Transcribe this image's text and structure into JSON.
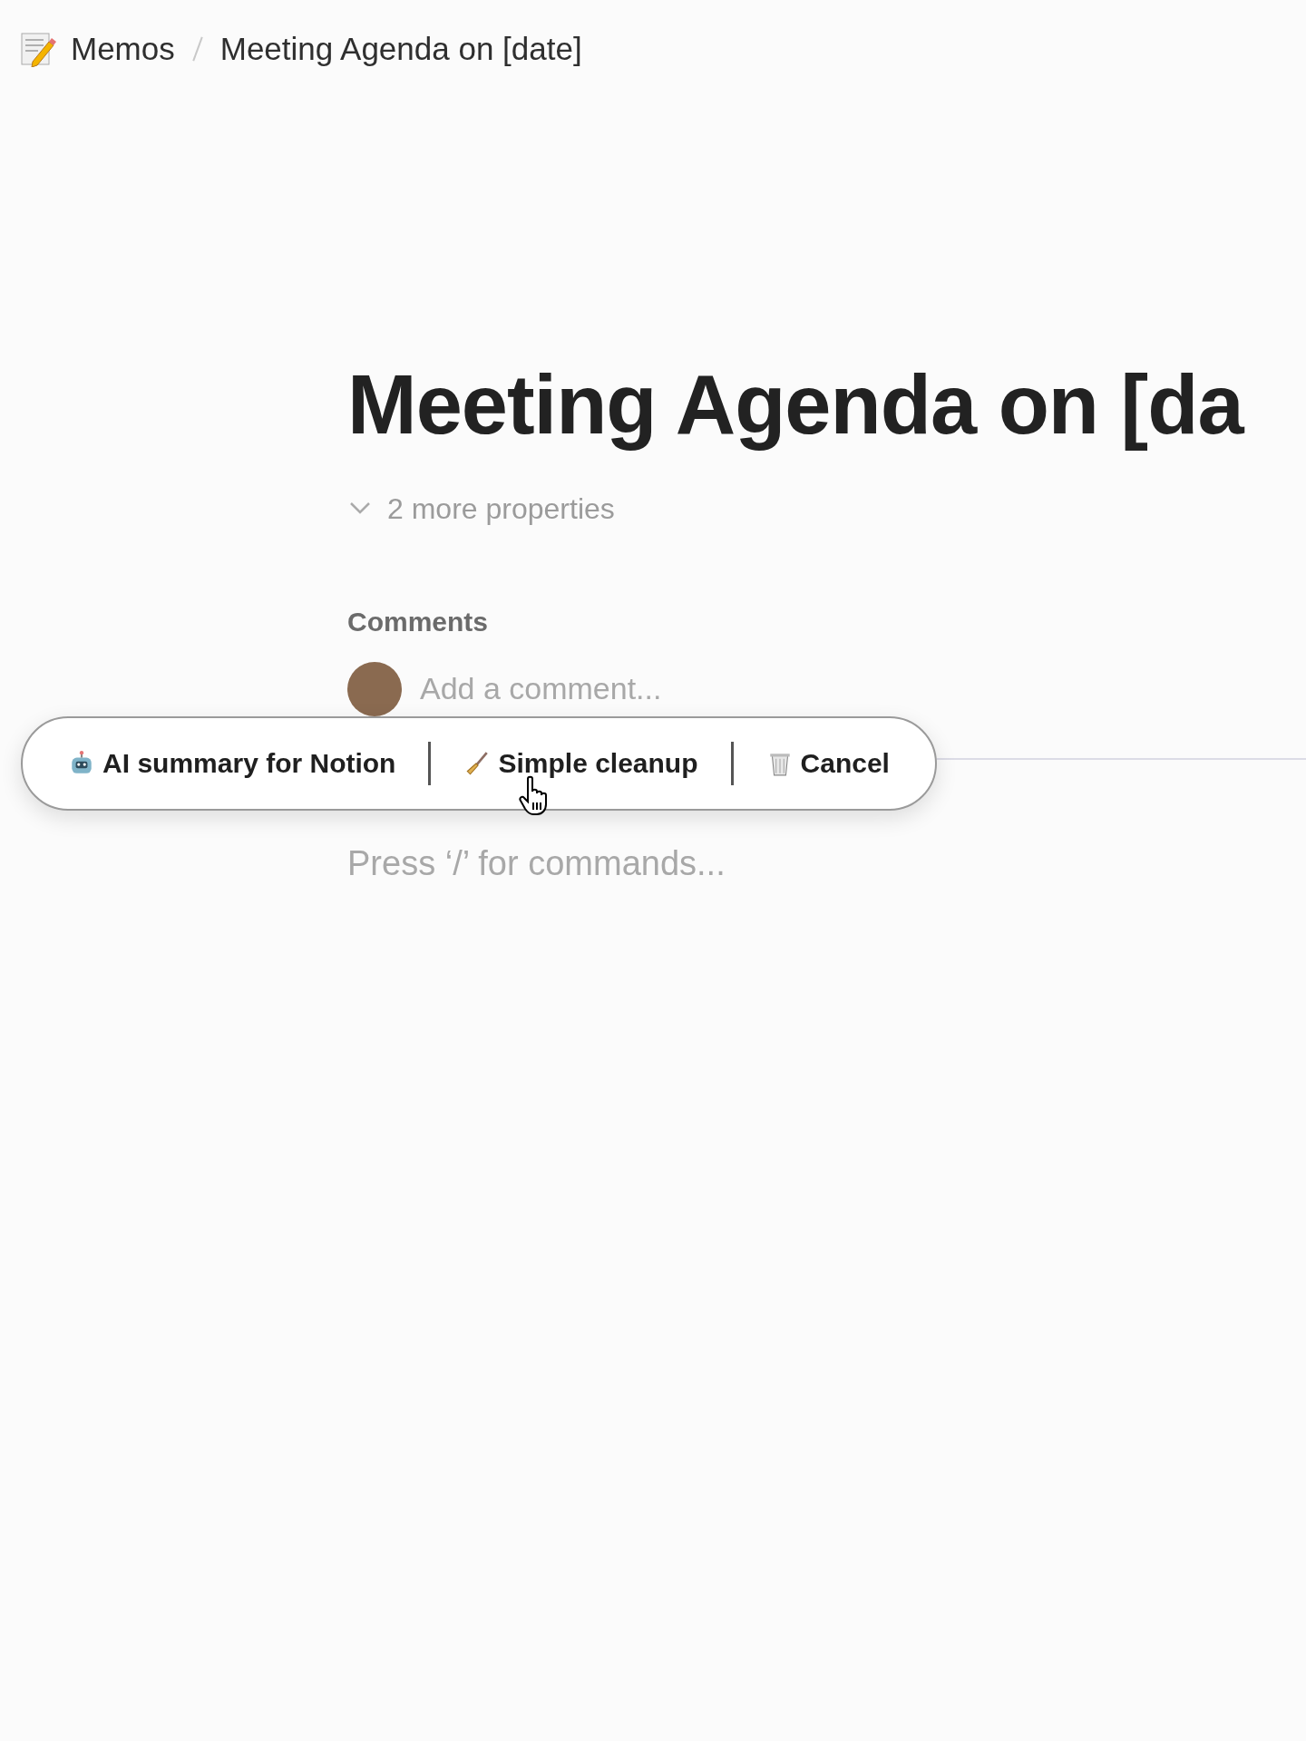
{
  "breadcrumb": [
    {
      "label": "Memos"
    },
    {
      "label": "Meeting Agenda on [date]"
    }
  ],
  "title": "Meeting Agenda on [da",
  "properties_toggle": {
    "label": "2 more properties",
    "expanded": false
  },
  "comments": {
    "heading": "Comments",
    "placeholder": "Add a comment..."
  },
  "action_bar": [
    {
      "label": "AI summary for Notion",
      "kind": "robot"
    },
    {
      "label": "Simple cleanup",
      "kind": "broom"
    },
    {
      "label": "Cancel",
      "kind": "trash"
    }
  ],
  "editor": {
    "placeholder": "Press ‘/’ for commands..."
  }
}
